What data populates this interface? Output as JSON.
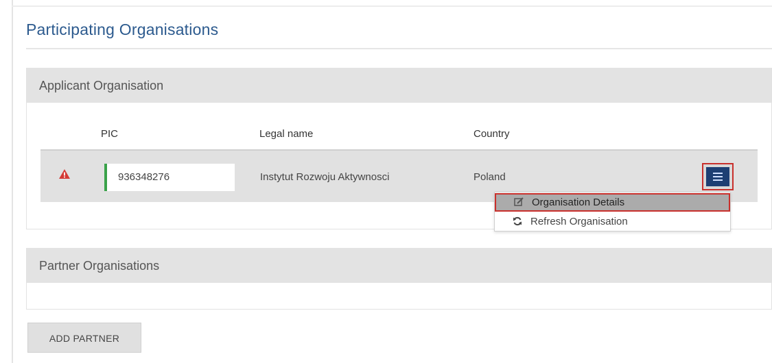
{
  "page": {
    "title": "Participating Organisations"
  },
  "applicant": {
    "header": "Applicant Organisation",
    "columns": {
      "pic": "PIC",
      "legal_name": "Legal name",
      "country": "Country"
    },
    "row": {
      "status_icon": "warning-triangle-icon",
      "pic": "936348276",
      "legal_name": "Instytut Rozwoju Aktywnosci",
      "country": "Poland",
      "menu_icon": "menu-list-icon"
    },
    "menu": {
      "items": [
        {
          "label": "Organisation Details",
          "icon": "edit-icon",
          "active": true
        },
        {
          "label": "Refresh Organisation",
          "icon": "refresh-icon",
          "active": false
        }
      ]
    }
  },
  "partner": {
    "header": "Partner Organisations"
  },
  "actions": {
    "add_partner": "ADD PARTNER"
  },
  "colors": {
    "title": "#2c5a8e",
    "status_ok_bar": "#3aa24a",
    "warning": "#d43a36",
    "menu_button": "#1d3f73",
    "highlight_border": "#c9302c"
  }
}
